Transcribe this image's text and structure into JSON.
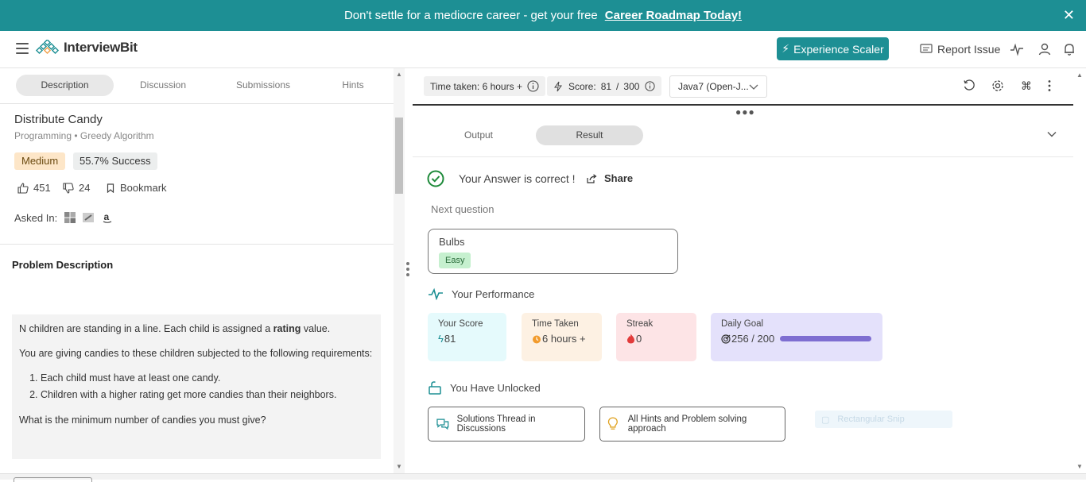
{
  "banner": {
    "message": "Don't settle for a mediocre career - get your free",
    "cta": "Career Roadmap Today!",
    "close": "✕"
  },
  "header": {
    "logo_text": "InterviewBit",
    "experience_button": "Experience Scaler",
    "report_issue": "Report Issue"
  },
  "left_tabs": [
    "Description",
    "Discussion",
    "Submissions",
    "Hints"
  ],
  "problem": {
    "title": "Distribute Candy",
    "category": "Programming",
    "topic": "Greedy Algorithm",
    "difficulty": "Medium",
    "success": "55.7% Success",
    "likes": "451",
    "dislikes": "24",
    "bookmark": "Bookmark",
    "asked_in_label": "Asked In:",
    "description_heading": "Problem Description",
    "desc_p1_before": "N children are standing in a line. Each child is assigned a ",
    "desc_p1_bold": "rating",
    "desc_p1_after": " value.",
    "desc_p2": "You are giving candies to these children subjected to the following requirements:",
    "requirements": [
      "Each child must have at least one candy.",
      "Children with a higher rating get more candies than their neighbors."
    ],
    "desc_p3": "What is the minimum number of candies you must give?"
  },
  "toolbar": {
    "time_taken": "Time taken: 6 hours +",
    "score_label": "Score:",
    "score_value": "81",
    "score_sep": "/",
    "score_max": "300",
    "language": "Java7 (Open-J..."
  },
  "result_tabs": [
    "Output",
    "Result"
  ],
  "result": {
    "status": "Your Answer is correct !",
    "share": "Share",
    "next_question_label": "Next question",
    "next_question_name": "Bulbs",
    "next_question_difficulty": "Easy",
    "performance_heading": "Your Performance",
    "cards": {
      "score_label": "Your Score",
      "score_value": "81",
      "time_label": "Time Taken",
      "time_value": "6 hours +",
      "streak_label": "Streak",
      "streak_value": "0",
      "goal_label": "Daily Goal",
      "goal_value": "256 / 200",
      "goal_progress": 1.0
    },
    "unlocked_heading": "You Have Unlocked",
    "unlocked_items": [
      "Solutions Thread in Discussions",
      "All Hints and Problem solving approach"
    ],
    "ghost_label": "Rectangular Snip"
  },
  "colors": {
    "brand": "#1d8f94",
    "medium_badge": "#fde6c8",
    "easy_badge": "#c6f0cf",
    "score_card": "#e5fafc",
    "time_card": "#fdf1e3",
    "streak_card": "#fde4e6",
    "goal_card": "#e4e1fb"
  }
}
